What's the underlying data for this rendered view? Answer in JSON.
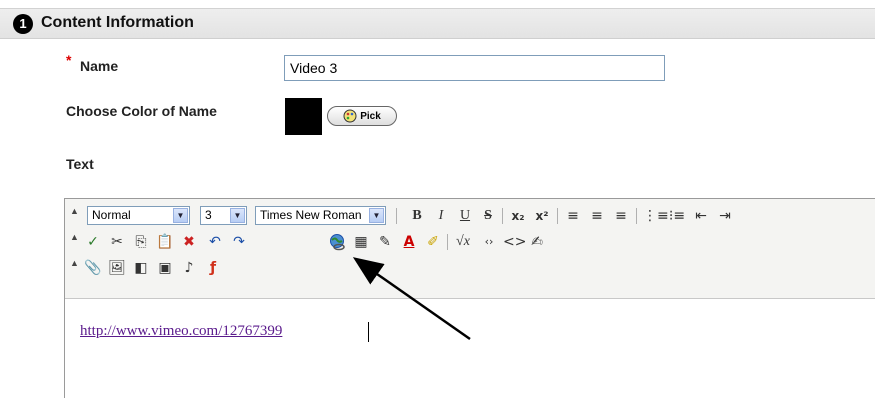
{
  "section": {
    "number": "1",
    "title": "Content Information"
  },
  "name_field": {
    "required_mark": "*",
    "label": "Name",
    "value": "Video 3"
  },
  "color_field": {
    "label": "Choose Color of Name",
    "swatch_color": "#000000",
    "pick_label": "Pick"
  },
  "text_field": {
    "label": "Text"
  },
  "toolbar": {
    "format_select": "Normal",
    "size_select": "3",
    "font_select": "Times New Roman",
    "bold": "B",
    "italic": "I",
    "underline": "U",
    "strike": "S",
    "subscript": "x₂",
    "superscript": "x²"
  },
  "editor_content": {
    "text": "http://www.vimeo.com/12767399",
    "link_color": "#5a1a8c"
  }
}
